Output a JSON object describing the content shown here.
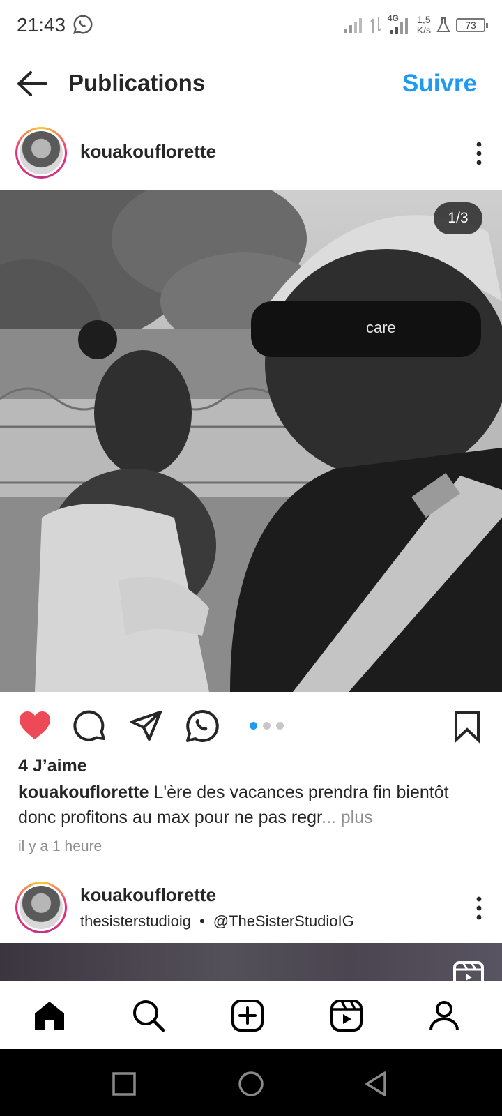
{
  "status_bar": {
    "time": "21:43",
    "network": "4G",
    "net_speed_value": "1,5",
    "net_speed_unit": "K/s",
    "battery": "73"
  },
  "header": {
    "title": "Publications",
    "follow_label": "Suivre"
  },
  "post": {
    "username": "kouakouflorette",
    "image_counter": "1/3",
    "sunglasses_text": "care",
    "carousel": {
      "count": 3,
      "active_index": 0
    },
    "liked": true,
    "likes_text": "4 J’aime",
    "caption_username": "kouakouflorette",
    "caption_text": " L'ère des vacances prendra fin bientôt donc profitons au max pour ne pas regr",
    "caption_more": "... plus",
    "time_ago": "il y a 1 heure"
  },
  "next_post": {
    "username": "kouakouflorette",
    "audio_source": "thesisterstudioig",
    "separator": "•",
    "mention": "@TheSisterStudioIG"
  },
  "colors": {
    "accent": "#1e9af5",
    "like": "#ed4956",
    "text": "#262626",
    "muted": "#8e8e8e"
  },
  "icons": {
    "back": "arrow-left-icon",
    "more": "three-dots-vertical-icon",
    "like": "heart-filled-icon",
    "comment": "comment-bubble-icon",
    "share": "paper-plane-icon",
    "whatsapp": "whatsapp-icon",
    "save": "bookmark-icon",
    "reel": "reels-icon",
    "nav": [
      "home-icon",
      "search-icon",
      "create-icon",
      "reels-icon",
      "profile-icon"
    ]
  }
}
